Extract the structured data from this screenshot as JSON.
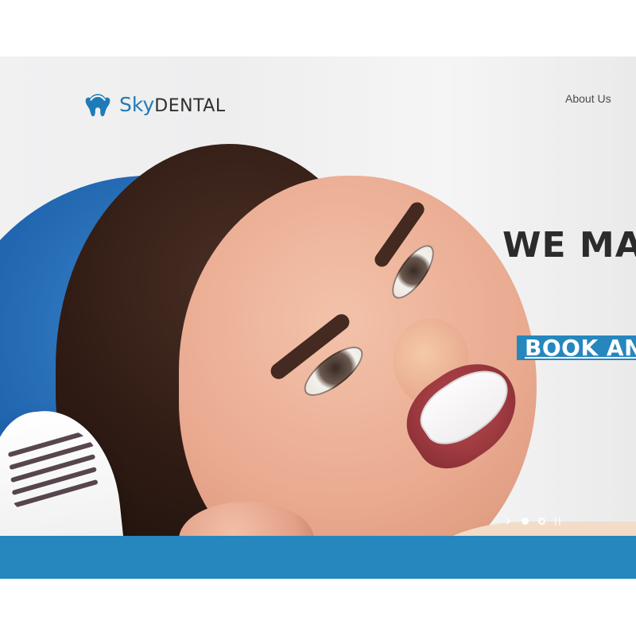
{
  "brand": {
    "prefix": "Sky",
    "name": "DENTAL",
    "colors": {
      "primary_blue": "#2587be",
      "logo_blue": "#1f7bb6",
      "text_dark": "#2b2b2b"
    },
    "icon": "tooth-logo-icon"
  },
  "nav": {
    "items": [
      {
        "label": "About Us"
      }
    ]
  },
  "hero": {
    "headline": "WE MAK",
    "cta_label": "BOOK AN",
    "slider": {
      "slides_count": 2,
      "active_index": 0,
      "next_icon": "chevron-right-icon",
      "pause_icon": "pause-icon"
    }
  }
}
